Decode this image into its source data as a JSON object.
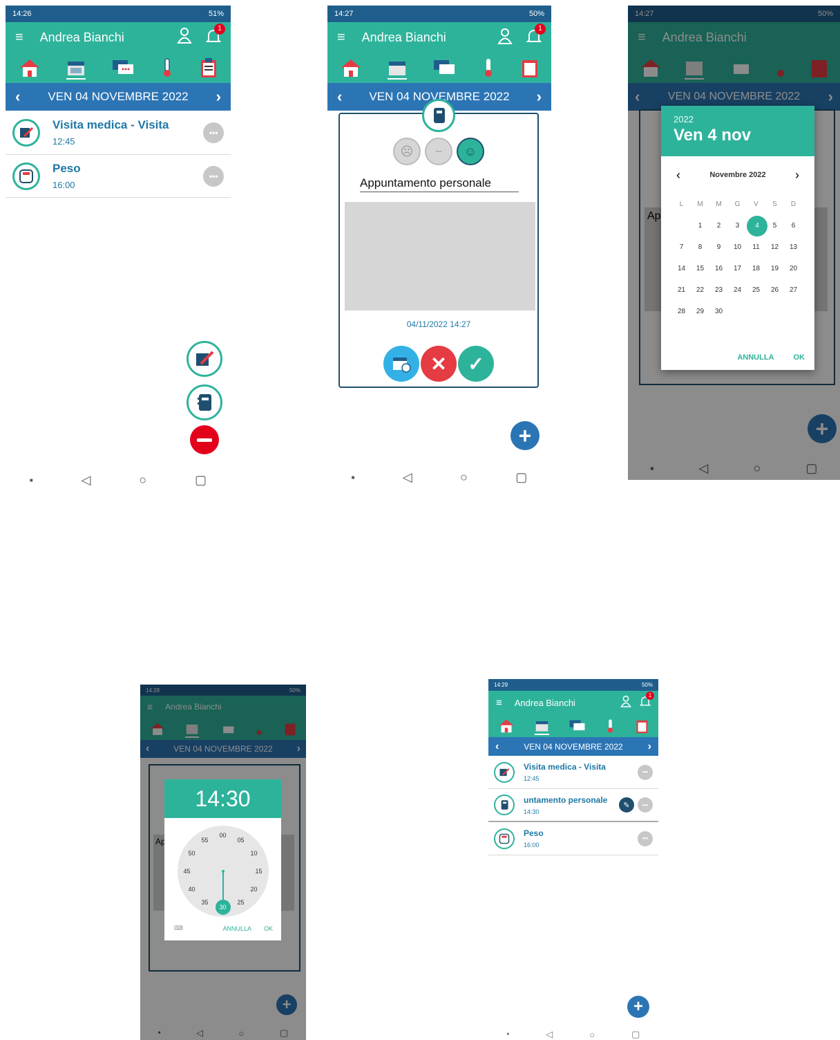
{
  "app": {
    "user_name": "Andrea Bianchi",
    "notification_count": "1",
    "date_header": "VEN 04 NOVEMBRE 2022",
    "colors": {
      "teal": "#2eb39b",
      "blue": "#2c75b5",
      "status": "#1f5e8c",
      "red": "#e53b43"
    }
  },
  "screens": [
    {
      "status_time": "14:26",
      "battery": "51%"
    },
    {
      "status_time": "14:27",
      "battery": "50%"
    },
    {
      "status_time": "14:27",
      "battery": "50%"
    },
    {
      "status_time": "14:28",
      "battery": "50%"
    },
    {
      "status_time": "14:29",
      "battery": "50%"
    }
  ],
  "entries": {
    "visita": {
      "title": "Visita medica - Visita",
      "time": "12:45"
    },
    "peso": {
      "title": "Peso",
      "time": "16:00"
    },
    "appuntamento": {
      "title": "untamento personale",
      "time": "14:30"
    }
  },
  "dialog": {
    "title_value": "Appuntamento personale",
    "timestamp": "04/11/2022 14:27",
    "background_note": "Ap"
  },
  "date_picker": {
    "year": "2022",
    "selected_label": "Ven 4 nov",
    "month_label": "Novembre 2022",
    "weekdays": [
      "L",
      "M",
      "M",
      "G",
      "V",
      "S",
      "D"
    ],
    "days": [
      "",
      "1",
      "2",
      "3",
      "4",
      "5",
      "6",
      "7",
      "8",
      "9",
      "10",
      "11",
      "12",
      "13",
      "14",
      "15",
      "16",
      "17",
      "18",
      "19",
      "20",
      "21",
      "22",
      "23",
      "24",
      "25",
      "26",
      "27",
      "28",
      "29",
      "30"
    ],
    "selected_day": "4",
    "cancel": "ANNULLA",
    "ok": "OK"
  },
  "time_picker": {
    "time": "14:30",
    "minute_labels": [
      "00",
      "05",
      "10",
      "15",
      "20",
      "25",
      "30",
      "35",
      "40",
      "45",
      "50",
      "55"
    ],
    "selected_minute": "30",
    "cancel": "ANNULLA",
    "ok": "OK"
  },
  "icons": [
    "menu-icon",
    "user-icon",
    "bell-icon",
    "home-icon",
    "calendar-icon",
    "chat-icon",
    "thermometer-icon",
    "clipboard-icon",
    "chevron-left-icon",
    "chevron-right-icon",
    "edit-icon",
    "notebook-icon",
    "scale-icon",
    "more-icon",
    "remove-icon",
    "plus-icon",
    "sad-face-icon",
    "neutral-face-icon",
    "happy-face-icon",
    "calendar-clock-icon",
    "close-icon",
    "check-icon",
    "keyboard-icon",
    "back-icon",
    "home-circle-icon",
    "recents-icon"
  ]
}
